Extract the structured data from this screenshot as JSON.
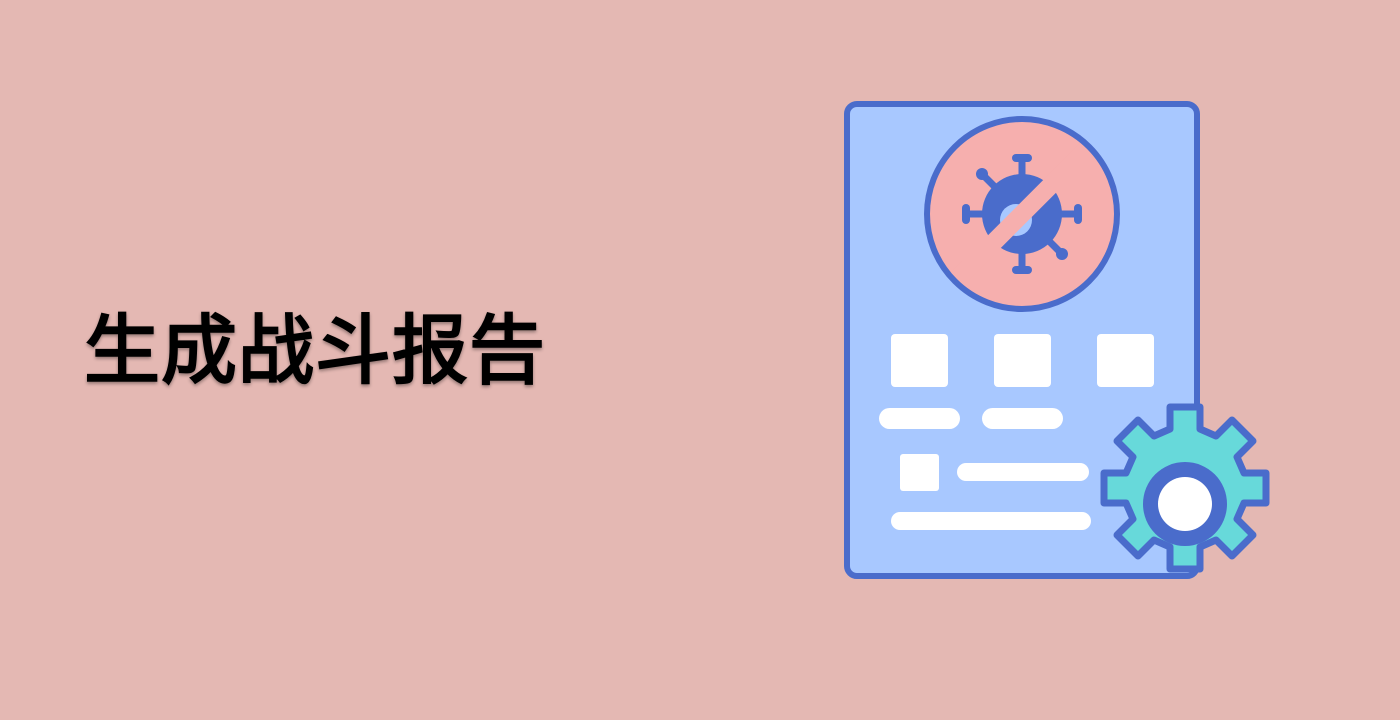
{
  "title": "生成战斗报告",
  "illustration": {
    "icons": [
      "report-document-icon",
      "no-virus-icon",
      "gear-icon"
    ]
  },
  "colors": {
    "background": "#E4B8B3",
    "title_text": "#000000",
    "document_fill": "#A8C8FF",
    "stroke": "#4A6CCB",
    "circle_fill": "#F6AFAE",
    "gear_fill": "#67D9DA",
    "white": "#FFFFFF"
  }
}
